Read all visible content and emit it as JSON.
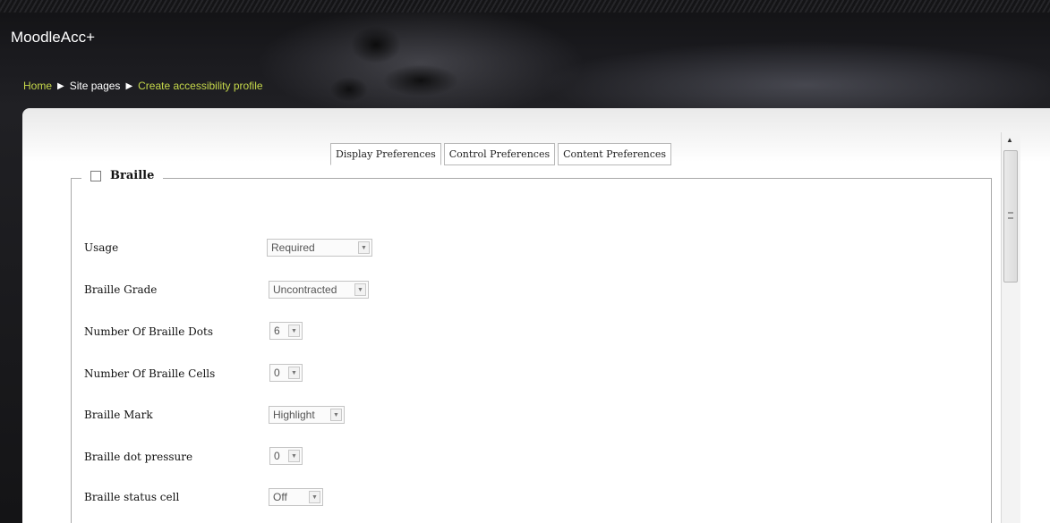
{
  "header": {
    "site_title": "MoodleAcc+"
  },
  "breadcrumb": {
    "items": [
      "Home",
      "Site pages",
      "Create accessibility profile"
    ],
    "separator": "▶"
  },
  "tabs": [
    {
      "label": "Display Preferences",
      "active": true
    },
    {
      "label": "Control Preferences",
      "active": false
    },
    {
      "label": "Content Preferences",
      "active": false
    }
  ],
  "section": {
    "legend": "Braille",
    "checked": false
  },
  "fields": [
    {
      "label": "Usage",
      "value": "Required"
    },
    {
      "label": "Braille Grade",
      "value": "Uncontracted"
    },
    {
      "label": "Number Of Braille Dots",
      "value": "6"
    },
    {
      "label": "Number Of Braille Cells",
      "value": "0"
    },
    {
      "label": "Braille Mark",
      "value": "Highlight"
    },
    {
      "label": "Braille dot pressure",
      "value": "0"
    },
    {
      "label": "Braille status cell",
      "value": "Off"
    }
  ],
  "icons": {
    "dropdown": "chevron-down-icon",
    "scroll_up": "scroll-up-arrow-icon"
  },
  "colors": {
    "breadcrumb_link": "#c6d84a",
    "header_bg": "#1a1a1e"
  }
}
